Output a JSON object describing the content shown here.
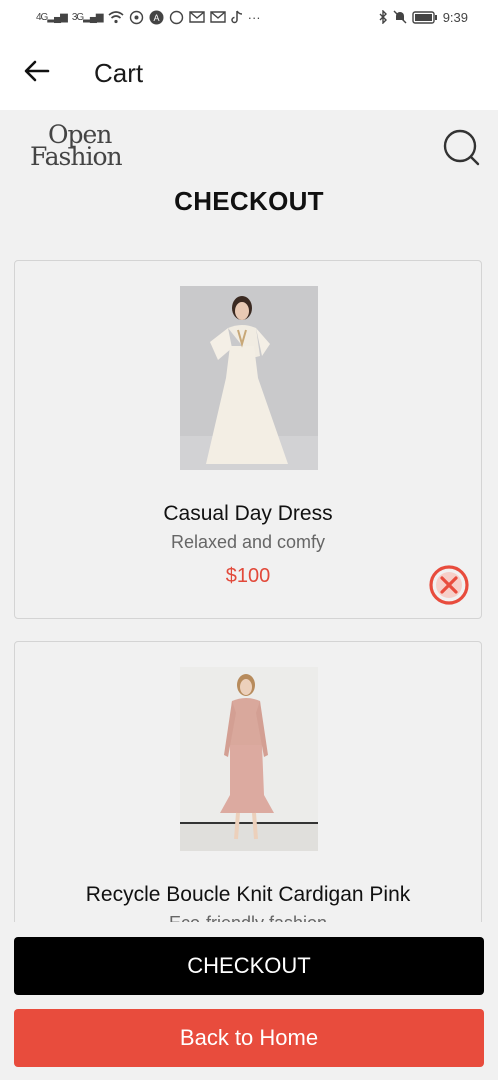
{
  "status": {
    "network_1": "4G",
    "network_2": "3G",
    "time": "9:39",
    "more_indicator": "···"
  },
  "appbar": {
    "title": "Cart",
    "back_icon": "arrow-left-icon"
  },
  "header": {
    "logo_line1": "Open",
    "logo_line2": "Fashion",
    "search_icon": "search-icon",
    "page_title": "CHECKOUT"
  },
  "cart": {
    "items": [
      {
        "name": "Casual Day Dress",
        "description": "Relaxed and comfy",
        "price": "$100",
        "remove_icon": "remove-circle-x-icon"
      },
      {
        "name": "Recycle Boucle Knit Cardigan Pink",
        "description": "Eco-friendly fashion"
      }
    ]
  },
  "buttons": {
    "checkout": "CHECKOUT",
    "back_home": "Back to Home"
  },
  "colors": {
    "accent_red": "#e84c3d",
    "price_red": "#e2493a",
    "checkout_black": "#000000"
  }
}
